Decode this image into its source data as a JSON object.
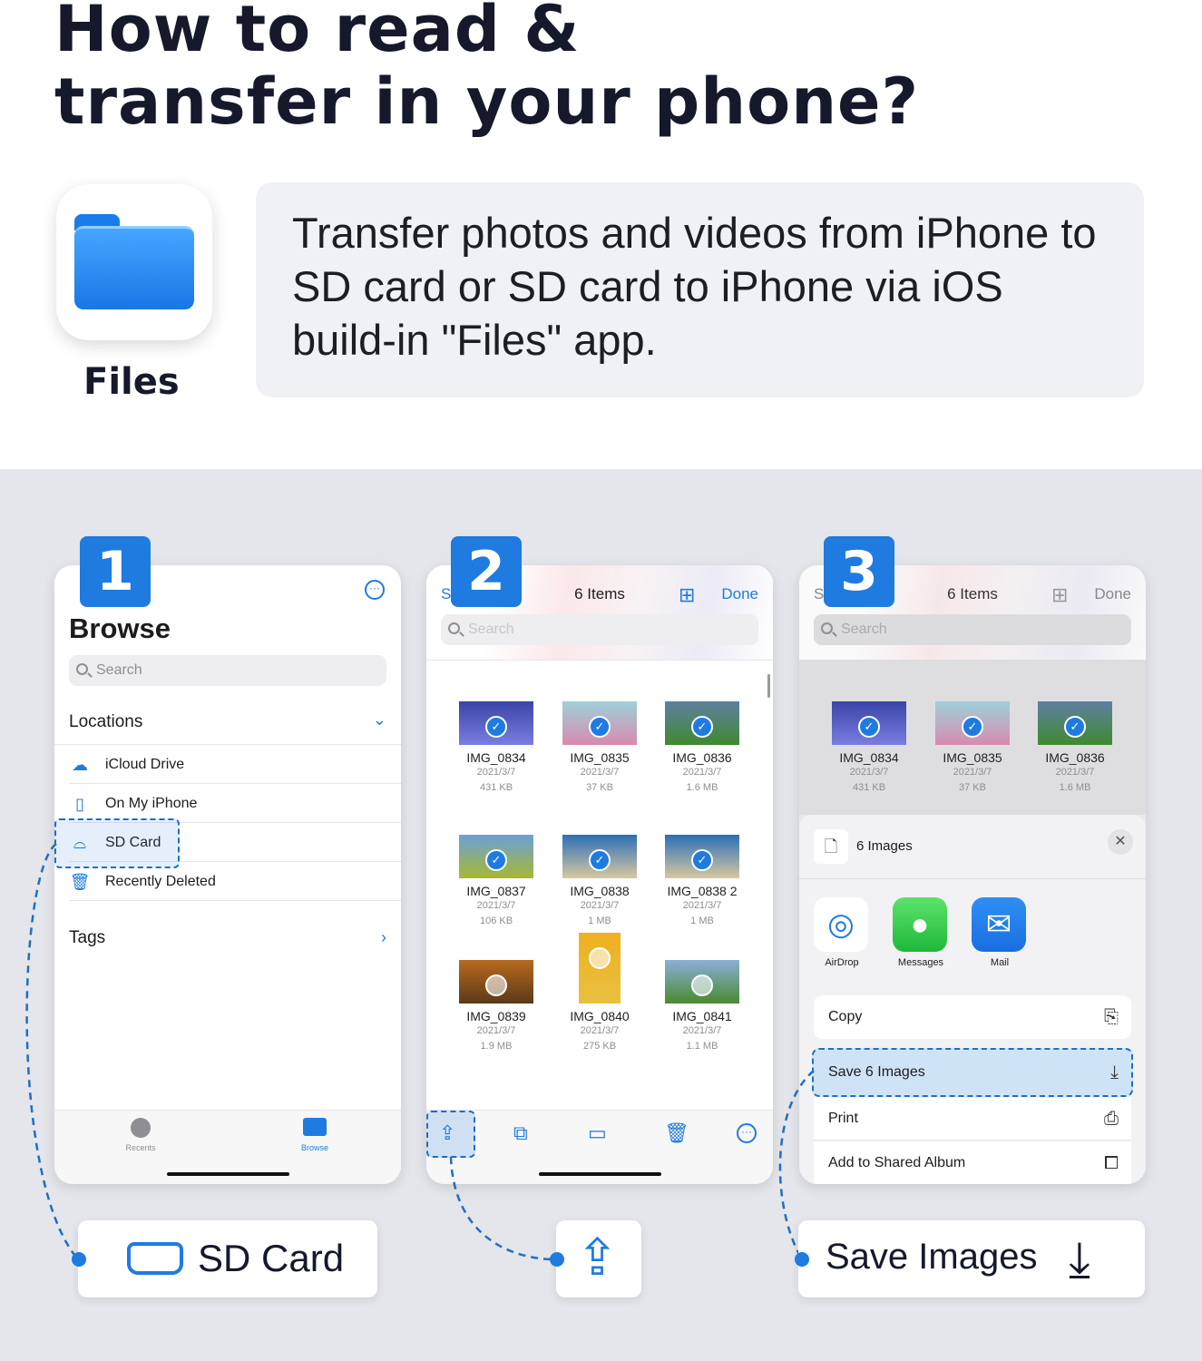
{
  "header": {
    "title_line1": "How to read &",
    "title_line2": "transfer in your phone?"
  },
  "app": {
    "name": "Files",
    "description": "Transfer photos and videos from iPhone to SD card or SD card to iPhone via iOS build-in \"Files\" app."
  },
  "steps": [
    "1",
    "2",
    "3"
  ],
  "phone1": {
    "title": "Browse",
    "search_placeholder": "Search",
    "locations_label": "Locations",
    "locations": [
      {
        "label": "iCloud Drive",
        "icon": "cloud-icon"
      },
      {
        "label": "On My iPhone",
        "icon": "phone-icon"
      },
      {
        "label": "SD Card",
        "icon": "drive-icon"
      },
      {
        "label": "Recently Deleted",
        "icon": "trash-icon"
      }
    ],
    "tags_label": "Tags",
    "tabs": [
      {
        "label": "Recents"
      },
      {
        "label": "Browse"
      }
    ]
  },
  "phone2": {
    "select_partial": "S",
    "title": "6 Items",
    "done": "Done",
    "search_placeholder": "Search",
    "files": [
      {
        "name": "IMG_0834",
        "date": "2021/3/7",
        "size": "431 KB",
        "selected": true,
        "colors": [
          "#3a44a8",
          "#7a7de0"
        ]
      },
      {
        "name": "IMG_0835",
        "date": "2021/3/7",
        "size": "37 KB",
        "selected": true,
        "colors": [
          "#9ed0da",
          "#d88ab0"
        ]
      },
      {
        "name": "IMG_0836",
        "date": "2021/3/7",
        "size": "1.6 MB",
        "selected": true,
        "colors": [
          "#5f7fa0",
          "#3f8a30"
        ]
      },
      {
        "name": "IMG_0837",
        "date": "2021/3/7",
        "size": "106 KB",
        "selected": true,
        "colors": [
          "#6aa0d8",
          "#a8b830"
        ]
      },
      {
        "name": "IMG_0838",
        "date": "2021/3/7",
        "size": "1 MB",
        "selected": true,
        "colors": [
          "#2a6fb8",
          "#d8c8a0"
        ]
      },
      {
        "name": "IMG_0838 2",
        "date": "2021/3/7",
        "size": "1 MB",
        "selected": true,
        "colors": [
          "#2a6fb8",
          "#d8c8a0"
        ]
      },
      {
        "name": "IMG_0839",
        "date": "2021/3/7",
        "size": "1.9 MB",
        "selected": false,
        "colors": [
          "#b86a20",
          "#5a3a18"
        ]
      },
      {
        "name": "IMG_0840",
        "date": "2021/3/7",
        "size": "275 KB",
        "selected": false,
        "colors": [
          "#f0b020",
          "#e8c040"
        ]
      },
      {
        "name": "IMG_0841",
        "date": "2021/3/7",
        "size": "1.1 MB",
        "selected": false,
        "colors": [
          "#8ab0d8",
          "#4a8a30"
        ]
      }
    ],
    "toolbar": [
      "share-icon",
      "duplicate-icon",
      "folder-icon",
      "trash-icon",
      "more-icon"
    ]
  },
  "phone3": {
    "select_partial": "S",
    "title": "6 Items",
    "done": "Done",
    "search_placeholder": "Search",
    "sheet_title": "6 Images",
    "apps": [
      {
        "label": "AirDrop"
      },
      {
        "label": "Messages"
      },
      {
        "label": "Mail"
      }
    ],
    "actions": [
      {
        "label": "Copy",
        "icon": "copy-icon"
      },
      {
        "label": "Save 6 Images",
        "icon": "save-icon",
        "highlighted": true
      },
      {
        "label": "Print",
        "icon": "print-icon"
      },
      {
        "label": "Add to Shared Album",
        "icon": "shared-album-icon"
      }
    ]
  },
  "callouts": {
    "sd_card": "SD Card",
    "save_images": "Save Images"
  },
  "colors": {
    "accent": "#1f7be0",
    "background": "#e4e6eb",
    "highlight": "#cfe3f7"
  }
}
